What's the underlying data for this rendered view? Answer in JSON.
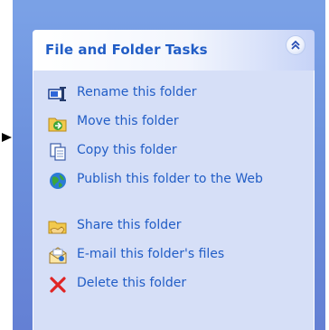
{
  "panel": {
    "title": "File and Folder Tasks",
    "collapse_icon": "double-chevron-up-icon"
  },
  "tasks": [
    {
      "label": "Rename this folder",
      "icon": "rename-icon"
    },
    {
      "label": "Move this folder",
      "icon": "move-folder-icon"
    },
    {
      "label": "Copy this folder",
      "icon": "copy-icon"
    },
    {
      "label": "Publish this folder to the Web",
      "icon": "publish-web-globe-icon"
    },
    {
      "label": "Share this folder",
      "icon": "share-folder-icon"
    },
    {
      "label": "E-mail this folder's files",
      "icon": "email-envelope-icon"
    },
    {
      "label": "Delete this folder",
      "icon": "delete-x-icon"
    }
  ],
  "colors": {
    "pane_blue": "#6b8fdc",
    "link_blue": "#215dc6",
    "body_bg": "#d6dff7"
  },
  "pointer_icon": "arrow-pointer-icon"
}
